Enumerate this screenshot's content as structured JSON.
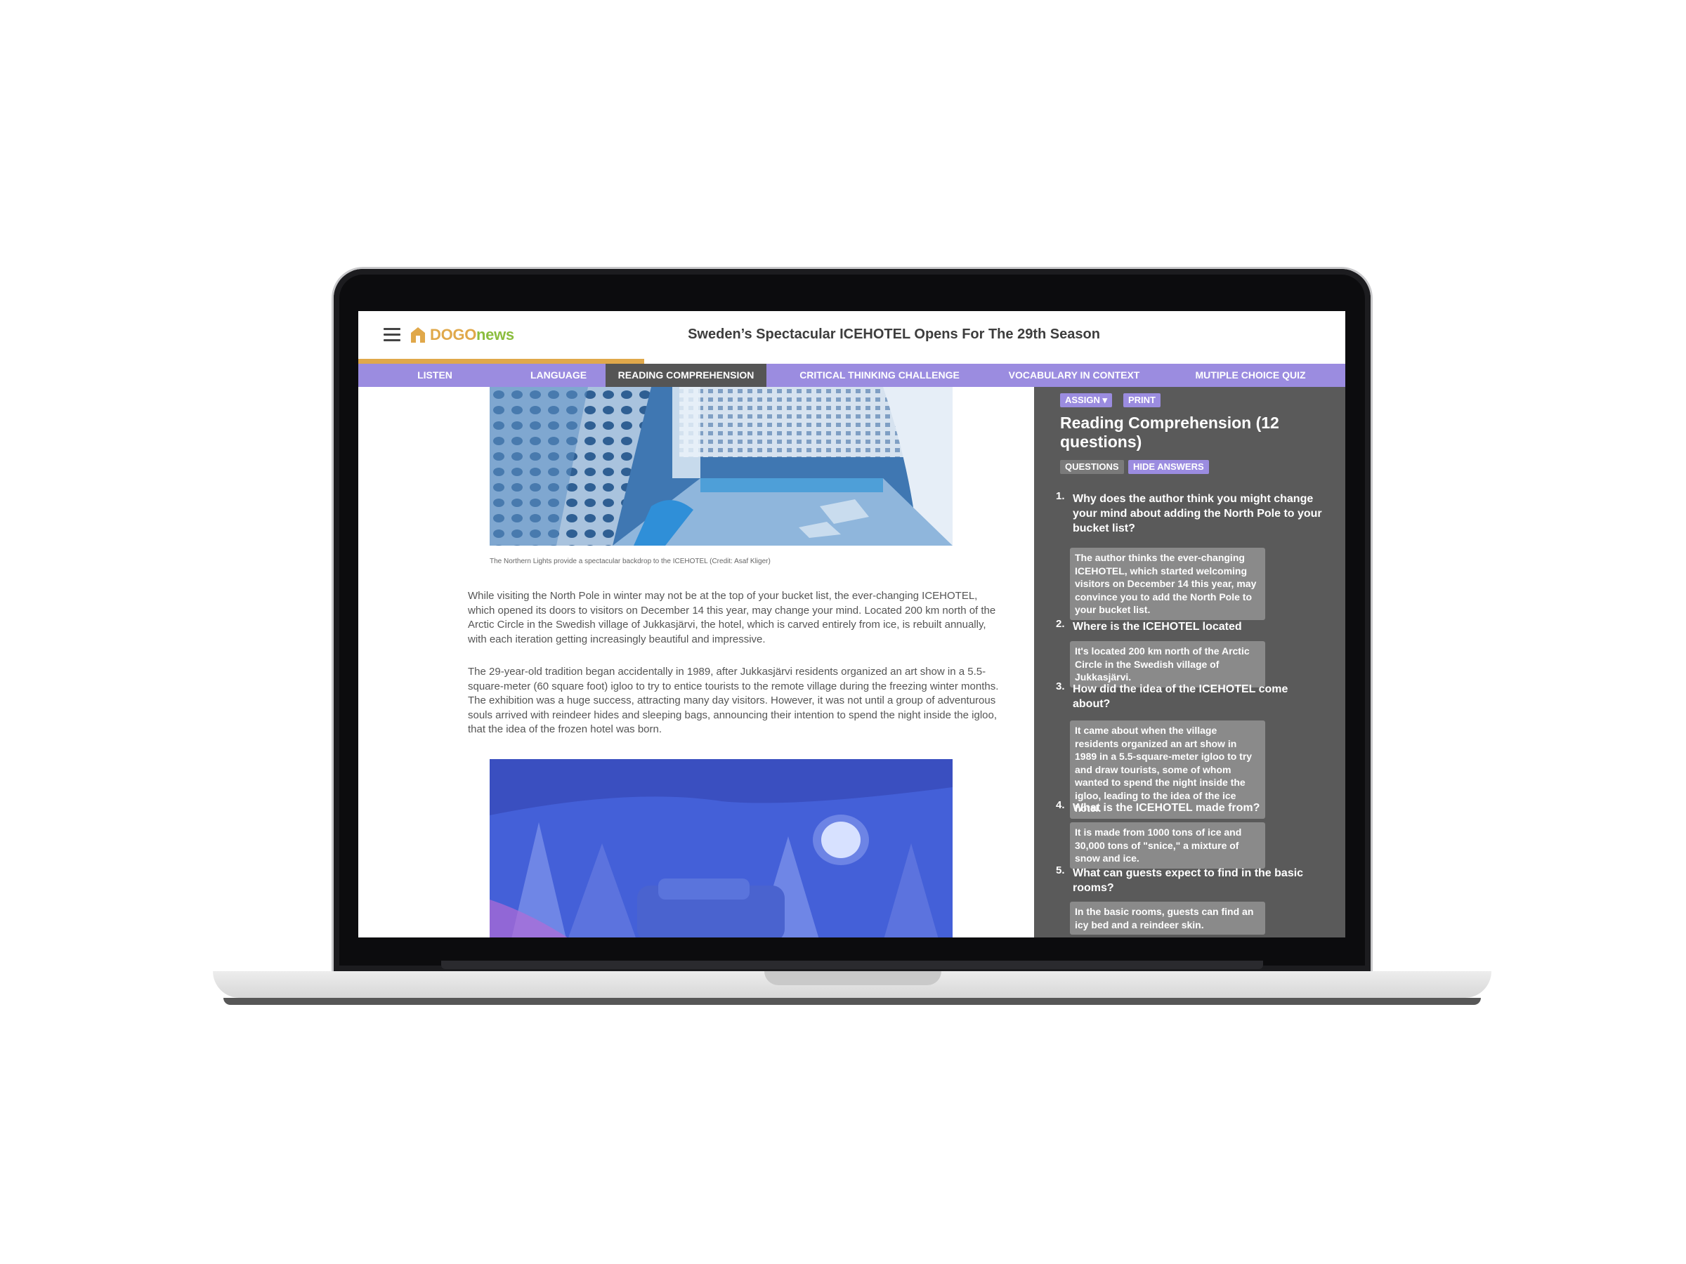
{
  "header": {
    "logo_text_1": "DOGO",
    "logo_text_2": "news",
    "title": "Sweden’s Spectacular ICEHOTEL Opens For The 29th Season"
  },
  "tabs": [
    {
      "label": "LISTEN"
    },
    {
      "label": "LANGUAGE"
    },
    {
      "label": "READING COMPREHENSION"
    },
    {
      "label": "CRITICAL THINKING CHALLENGE"
    },
    {
      "label": "VOCABULARY IN CONTEXT"
    },
    {
      "label": "MUTIPLE CHOICE QUIZ"
    }
  ],
  "article": {
    "photo1_caption": "The Northern Lights provide a spectacular backdrop to the ICEHOTEL (Credit: Asaf Kliger)",
    "paragraph1": "While visiting the North Pole in winter may not be at the top of your bucket list, the ever-changing ICEHOTEL, which opened its doors to visitors on December 14 this year, may change your mind. Located 200 km north of the Arctic Circle in the Swedish village of Jukkasjärvi, the hotel, which is carved entirely from ice, is rebuilt annually, with each iteration getting increasingly beautiful and impressive.",
    "paragraph2": "The 29-year-old tradition began accidentally in 1989, after Jukkasjärvi residents organized an art show in a 5.5-square-meter (60 square foot) igloo to try to entice tourists to the remote village during the freezing winter months. The exhibition was a huge success, attracting many day visitors. However, it was not until a group of adventurous souls arrived with reindeer hides and sleeping bags, announcing their intention to spend the night inside the igloo, that the idea of the frozen hotel was born."
  },
  "sidebar": {
    "assign_label": "ASSIGN ▾",
    "print_label": "PRINT",
    "title": "Reading Comprehension (12 questions)",
    "questions_label": "QUESTIONS",
    "hide_answers_label": "HIDE ANSWERS",
    "questions": [
      {
        "num": "1.",
        "question": "Why does the author think you might change your mind about adding the North Pole to your bucket list?",
        "answer": "The author thinks the ever-changing ICEHOTEL, which started welcoming visitors on December 14 this year, may convince you to add the North Pole to your bucket list."
      },
      {
        "num": "2.",
        "question": "Where is the ICEHOTEL located",
        "answer": "It's located 200 km north of the Arctic Circle in the Swedish village of Jukkasjärvi."
      },
      {
        "num": "3.",
        "question": "How did the idea of the ICEHOTEL come about?",
        "answer": "It came about when the village residents organized an art show in 1989 in a 5.5-square-meter igloo to try and draw tourists, some of whom wanted to spend the night inside the igloo, leading to the idea of the ice hotel."
      },
      {
        "num": "4.",
        "question": "What is the ICEHOTEL made from?",
        "answer": "It is made from 1000 tons of ice and 30,000 tons of \"snice,\" a mixture of snow and ice."
      },
      {
        "num": "5.",
        "question": "What can guests expect to find in the basic rooms?",
        "answer": "In the basic rooms, guests can find an icy bed and a reindeer skin."
      }
    ]
  },
  "colors": {
    "tab_bar": "#9b8ce0",
    "active_tab": "#555555",
    "progress": "#e0a84a",
    "sidebar_bg": "#5a5a5a",
    "answer_bg": "#8a8a8a"
  }
}
